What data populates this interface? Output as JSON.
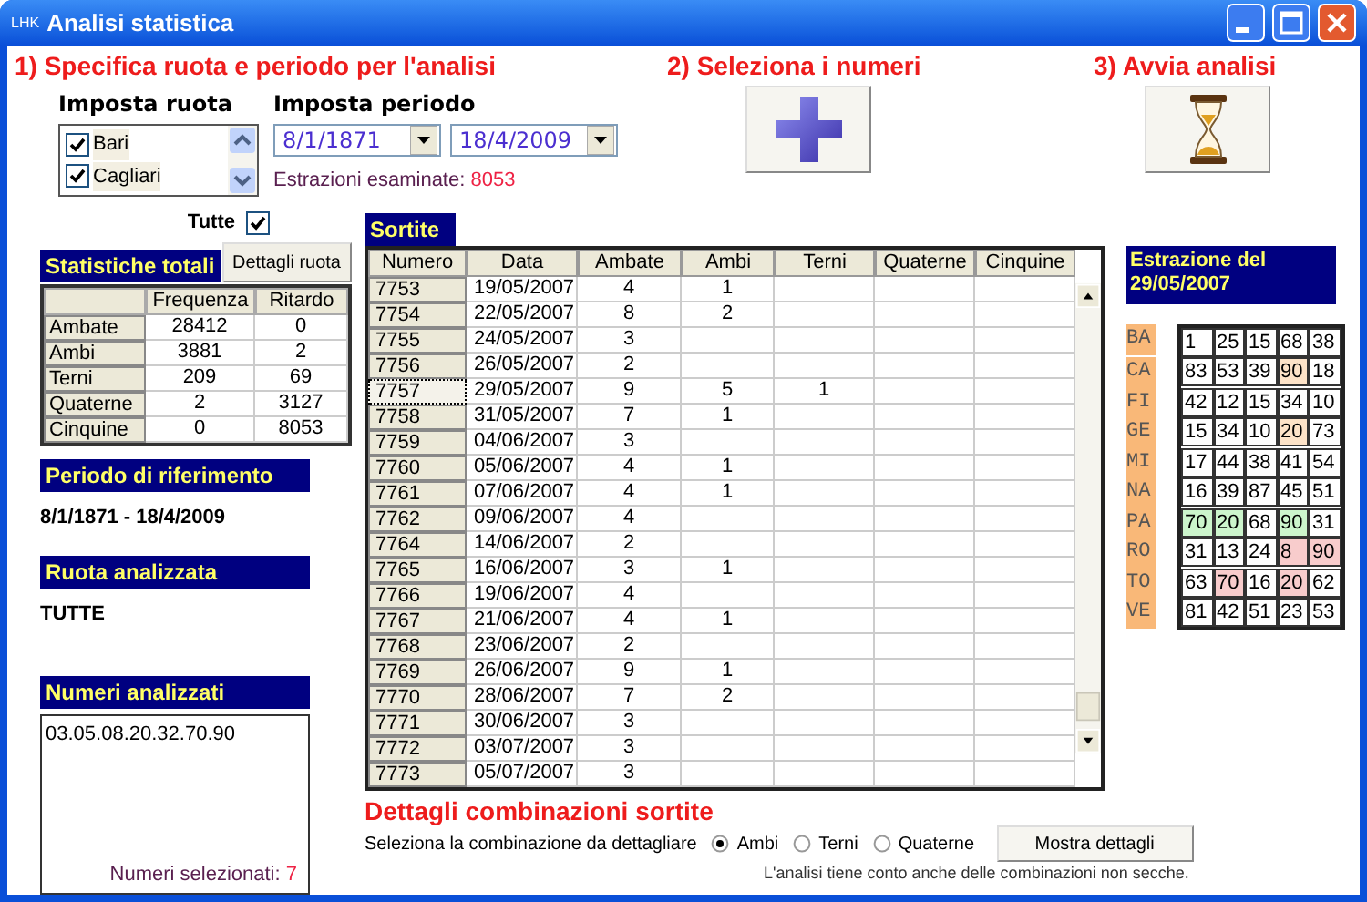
{
  "window": {
    "logo": "LHK",
    "title": "Analisi statistica"
  },
  "step1": {
    "heading": "1) Specifica ruota e periodo per l'analisi",
    "ruota": {
      "label": "Imposta ruota",
      "items": [
        {
          "name": "Bari",
          "checked": true
        },
        {
          "name": "Cagliari",
          "checked": true
        }
      ]
    },
    "periodo": {
      "label": "Imposta periodo",
      "from": "8/1/1871",
      "to": "18/4/2009",
      "count_label": "Estrazioni esaminate:",
      "count": "8053"
    }
  },
  "step2": {
    "heading": "2) Seleziona i numeri"
  },
  "step3": {
    "heading": "3) Avvia analisi"
  },
  "tutte": {
    "label": "Tutte",
    "checked": true
  },
  "statistiche": {
    "title": "Statistiche totali",
    "button": "Dettagli ruota",
    "columns": [
      "Frequenza",
      "Ritardo"
    ],
    "rows": [
      {
        "label": "Ambate",
        "values": [
          "28412",
          "0"
        ]
      },
      {
        "label": "Ambi",
        "values": [
          "3881",
          "2"
        ]
      },
      {
        "label": "Terni",
        "values": [
          "209",
          "69"
        ]
      },
      {
        "label": "Quaterne",
        "values": [
          "2",
          "3127"
        ]
      },
      {
        "label": "Cinquine",
        "values": [
          "0",
          "8053"
        ]
      }
    ]
  },
  "periodo_riferimento": {
    "title": "Periodo di riferimento",
    "value": "8/1/1871 - 18/4/2009"
  },
  "ruota_analizzata": {
    "title": "Ruota analizzata",
    "value": "TUTTE"
  },
  "numeri_analizzati": {
    "title": "Numeri analizzati",
    "value": "03.05.08.20.32.70.90",
    "count_label": "Numeri selezionati:",
    "count": "7"
  },
  "sortite": {
    "title": "Sortite",
    "columns": [
      "Numero",
      "Data",
      "Ambate",
      "Ambi",
      "Terni",
      "Quaterne",
      "Cinquine"
    ],
    "rows": [
      {
        "cells": [
          "7753",
          "19/05/2007",
          "4",
          "1",
          null,
          null,
          null
        ],
        "selected": false
      },
      {
        "cells": [
          "7754",
          "22/05/2007",
          "8",
          "2",
          null,
          null,
          null
        ],
        "selected": false
      },
      {
        "cells": [
          "7755",
          "24/05/2007",
          "3",
          null,
          null,
          null,
          null
        ],
        "selected": false
      },
      {
        "cells": [
          "7756",
          "26/05/2007",
          "2",
          null,
          null,
          null,
          null
        ],
        "selected": false
      },
      {
        "cells": [
          "7757",
          "29/05/2007",
          "9",
          "5",
          "1",
          null,
          null
        ],
        "selected": true
      },
      {
        "cells": [
          "7758",
          "31/05/2007",
          "7",
          "1",
          null,
          null,
          null
        ],
        "selected": false
      },
      {
        "cells": [
          "7759",
          "04/06/2007",
          "3",
          null,
          null,
          null,
          null
        ],
        "selected": false
      },
      {
        "cells": [
          "7760",
          "05/06/2007",
          "4",
          "1",
          null,
          null,
          null
        ],
        "selected": false
      },
      {
        "cells": [
          "7761",
          "07/06/2007",
          "4",
          "1",
          null,
          null,
          null
        ],
        "selected": false
      },
      {
        "cells": [
          "7762",
          "09/06/2007",
          "4",
          null,
          null,
          null,
          null
        ],
        "selected": false
      },
      {
        "cells": [
          "7764",
          "14/06/2007",
          "2",
          null,
          null,
          null,
          null
        ],
        "selected": false
      },
      {
        "cells": [
          "7765",
          "16/06/2007",
          "3",
          "1",
          null,
          null,
          null
        ],
        "selected": false
      },
      {
        "cells": [
          "7766",
          "19/06/2007",
          "4",
          null,
          null,
          null,
          null
        ],
        "selected": false
      },
      {
        "cells": [
          "7767",
          "21/06/2007",
          "4",
          "1",
          null,
          null,
          null
        ],
        "selected": false
      },
      {
        "cells": [
          "7768",
          "23/06/2007",
          "2",
          null,
          null,
          null,
          null
        ],
        "selected": false
      },
      {
        "cells": [
          "7769",
          "26/06/2007",
          "9",
          "1",
          null,
          null,
          null
        ],
        "selected": false
      },
      {
        "cells": [
          "7770",
          "28/06/2007",
          "7",
          "2",
          null,
          null,
          null
        ],
        "selected": false
      },
      {
        "cells": [
          "7771",
          "30/06/2007",
          "3",
          null,
          null,
          null,
          null
        ],
        "selected": false
      },
      {
        "cells": [
          "7772",
          "03/07/2007",
          "3",
          null,
          null,
          null,
          null
        ],
        "selected": false
      },
      {
        "cells": [
          "7773",
          "05/07/2007",
          "3",
          null,
          null,
          null,
          null
        ],
        "selected": false
      }
    ]
  },
  "dettagli": {
    "heading": "Dettagli combinazioni sortite",
    "prompt": "Seleziona la combinazione da dettagliare",
    "options": [
      {
        "label": "Ambi",
        "selected": true
      },
      {
        "label": "Terni",
        "selected": false
      },
      {
        "label": "Quaterne",
        "selected": false
      }
    ],
    "button": "Mostra dettagli",
    "note": "L'analisi tiene conto anche delle combinazioni non secche."
  },
  "estrazione": {
    "title": "Estrazione del 29/05/2007",
    "wheels": [
      {
        "label": "BA",
        "numbers": [
          {
            "value": "1",
            "color": "#ffffff"
          },
          {
            "value": "25",
            "color": "#ffffff"
          },
          {
            "value": "15",
            "color": "#ffffff"
          },
          {
            "value": "68",
            "color": "#ffffff"
          },
          {
            "value": "38",
            "color": "#ffffff"
          }
        ]
      },
      {
        "label": "CA",
        "numbers": [
          {
            "value": "83",
            "color": "#ffffff"
          },
          {
            "value": "53",
            "color": "#ffffff"
          },
          {
            "value": "39",
            "color": "#ffffff"
          },
          {
            "value": "90",
            "color": "#fde3c8"
          },
          {
            "value": "18",
            "color": "#ffffff"
          }
        ]
      },
      {
        "label": "FI",
        "numbers": [
          {
            "value": "42",
            "color": "#ffffff"
          },
          {
            "value": "12",
            "color": "#ffffff"
          },
          {
            "value": "15",
            "color": "#ffffff"
          },
          {
            "value": "34",
            "color": "#ffffff"
          },
          {
            "value": "10",
            "color": "#ffffff"
          }
        ]
      },
      {
        "label": "GE",
        "numbers": [
          {
            "value": "15",
            "color": "#ffffff"
          },
          {
            "value": "34",
            "color": "#ffffff"
          },
          {
            "value": "10",
            "color": "#ffffff"
          },
          {
            "value": "20",
            "color": "#fde3c8"
          },
          {
            "value": "73",
            "color": "#ffffff"
          }
        ]
      },
      {
        "label": "MI",
        "numbers": [
          {
            "value": "17",
            "color": "#ffffff"
          },
          {
            "value": "44",
            "color": "#ffffff"
          },
          {
            "value": "38",
            "color": "#ffffff"
          },
          {
            "value": "41",
            "color": "#ffffff"
          },
          {
            "value": "54",
            "color": "#ffffff"
          }
        ]
      },
      {
        "label": "NA",
        "numbers": [
          {
            "value": "16",
            "color": "#ffffff"
          },
          {
            "value": "39",
            "color": "#ffffff"
          },
          {
            "value": "87",
            "color": "#ffffff"
          },
          {
            "value": "45",
            "color": "#ffffff"
          },
          {
            "value": "51",
            "color": "#ffffff"
          }
        ]
      },
      {
        "label": "PA",
        "numbers": [
          {
            "value": "70",
            "color": "#ccf5cc"
          },
          {
            "value": "20",
            "color": "#ccf5cc"
          },
          {
            "value": "68",
            "color": "#ffffff"
          },
          {
            "value": "90",
            "color": "#ccf5cc"
          },
          {
            "value": "31",
            "color": "#ffffff"
          }
        ]
      },
      {
        "label": "RO",
        "numbers": [
          {
            "value": "31",
            "color": "#ffffff"
          },
          {
            "value": "13",
            "color": "#ffffff"
          },
          {
            "value": "24",
            "color": "#ffffff"
          },
          {
            "value": "8",
            "color": "#f8cccc"
          },
          {
            "value": "90",
            "color": "#f8cccc"
          }
        ]
      },
      {
        "label": "TO",
        "numbers": [
          {
            "value": "63",
            "color": "#ffffff"
          },
          {
            "value": "70",
            "color": "#f8cccc"
          },
          {
            "value": "16",
            "color": "#ffffff"
          },
          {
            "value": "20",
            "color": "#f8cccc"
          },
          {
            "value": "62",
            "color": "#ffffff"
          }
        ]
      },
      {
        "label": "VE",
        "numbers": [
          {
            "value": "81",
            "color": "#ffffff"
          },
          {
            "value": "42",
            "color": "#ffffff"
          },
          {
            "value": "51",
            "color": "#ffffff"
          },
          {
            "value": "23",
            "color": "#ffffff"
          },
          {
            "value": "53",
            "color": "#ffffff"
          }
        ]
      }
    ]
  }
}
